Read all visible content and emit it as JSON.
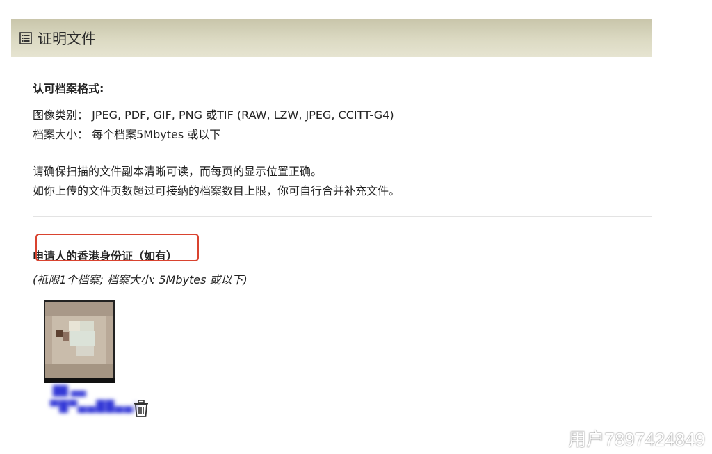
{
  "section": {
    "title": "证明文件",
    "icon": "list-icon"
  },
  "formats": {
    "title": "认可档案格式:",
    "image_types": "图像类别：  JPEG, PDF, GIF, PNG 或TIF (RAW, LZW, JPEG, CCITT-G4)",
    "file_size": "档案大小：  每个档案5Mbytes 或以下",
    "notice_1": "请确保扫描的文件副本清晰可读，而每页的显示位置正确。",
    "notice_2": "如你上传的文件页数超过可接纳的档案数目上限，你可自行合并补充文件。"
  },
  "hkid": {
    "title": "申请人的香港身份证（如有）",
    "note": "(祇限1个档案; 档案大小: 5Mbytes 或以下)",
    "highlight_color": "#d9432f",
    "thumbnail_icon": "document-thumbnail",
    "file_name_line1": "██ ▄▄",
    "file_name_line2": "▀█▀▄▄██▄▄)",
    "delete_icon": "trash-icon"
  },
  "watermark": {
    "text": "用户7897424849",
    "icon": "weibo-icon"
  },
  "colors": {
    "header_bg": "#d6d3bc",
    "link": "#3338d6"
  }
}
